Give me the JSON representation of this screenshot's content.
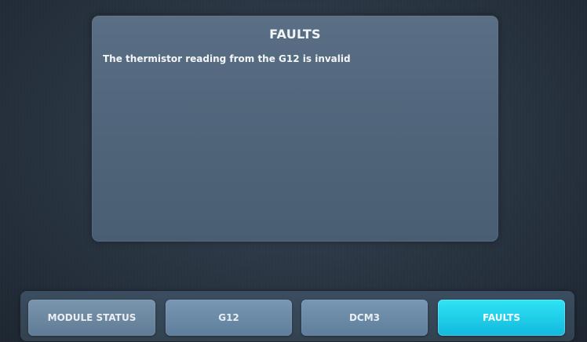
{
  "panel": {
    "title": "FAULTS",
    "faults": [
      "The thermistor reading from the G12 is invalid"
    ]
  },
  "tabs": [
    {
      "label": "MODULE STATUS",
      "active": false
    },
    {
      "label": "G12",
      "active": false
    },
    {
      "label": "DCM3",
      "active": false
    },
    {
      "label": "FAULTS",
      "active": true
    }
  ],
  "colors": {
    "active_tab": "#1ecbe9",
    "inactive_tab": "#6d8ba8",
    "panel": "#54697e",
    "background": "#2b3744"
  }
}
